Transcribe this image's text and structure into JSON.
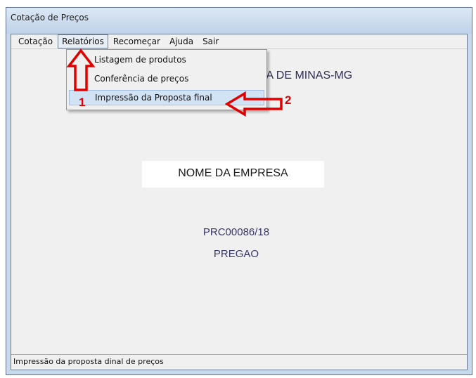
{
  "window": {
    "title": "Cotação de Preços"
  },
  "menubar": {
    "items": [
      {
        "label": "Cotação"
      },
      {
        "label": "Relatórios"
      },
      {
        "label": "Recomeçar"
      },
      {
        "label": "Ajuda"
      },
      {
        "label": "Sair"
      }
    ]
  },
  "dropdown": {
    "items": [
      {
        "label": "Listagem de produtos"
      },
      {
        "label": "Conferência de preços"
      },
      {
        "label": "Impressão da Proposta final"
      }
    ]
  },
  "content": {
    "header_fragment": "RA DE MINAS-MG",
    "company_name": "NOME DA EMPRESA",
    "process_number": "PRC00086/18",
    "modality": "PREGAO"
  },
  "statusbar": {
    "text": "Impressão da proposta dinal de preços"
  },
  "annotations": {
    "step1": "1",
    "step2": "2",
    "color": "#e00000"
  }
}
